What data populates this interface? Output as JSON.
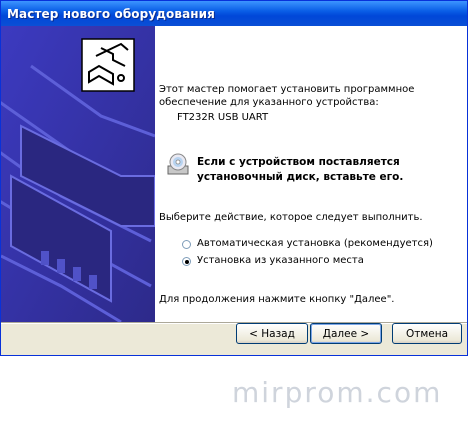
{
  "window": {
    "title": "Мастер нового оборудования"
  },
  "intro": {
    "line1": "Этот мастер помогает установить программное",
    "line2": "обеспечение для указанного устройства:",
    "device": "FT232R USB UART"
  },
  "cd_notice": {
    "icon": "cd-drive-icon",
    "line1": "Если с устройством поставляется",
    "line2": "установочный диск, вставьте его."
  },
  "choice": {
    "prompt": "Выберите действие, которое следует выполнить.",
    "options": [
      {
        "label": "Автоматическая установка (рекомендуется)",
        "selected": false
      },
      {
        "label": "Установка из указанного места",
        "selected": true
      }
    ]
  },
  "continue_hint": "Для продолжения нажмите кнопку \"Далее\".",
  "buttons": {
    "back": "< Назад",
    "next": "Далее >",
    "cancel": "Отмена"
  },
  "colors": {
    "side_panel": "#3f3aa8",
    "title_bar": "#0a5ee6",
    "dialog_bg": "#ece9d8"
  },
  "watermark": "mirprom.com"
}
